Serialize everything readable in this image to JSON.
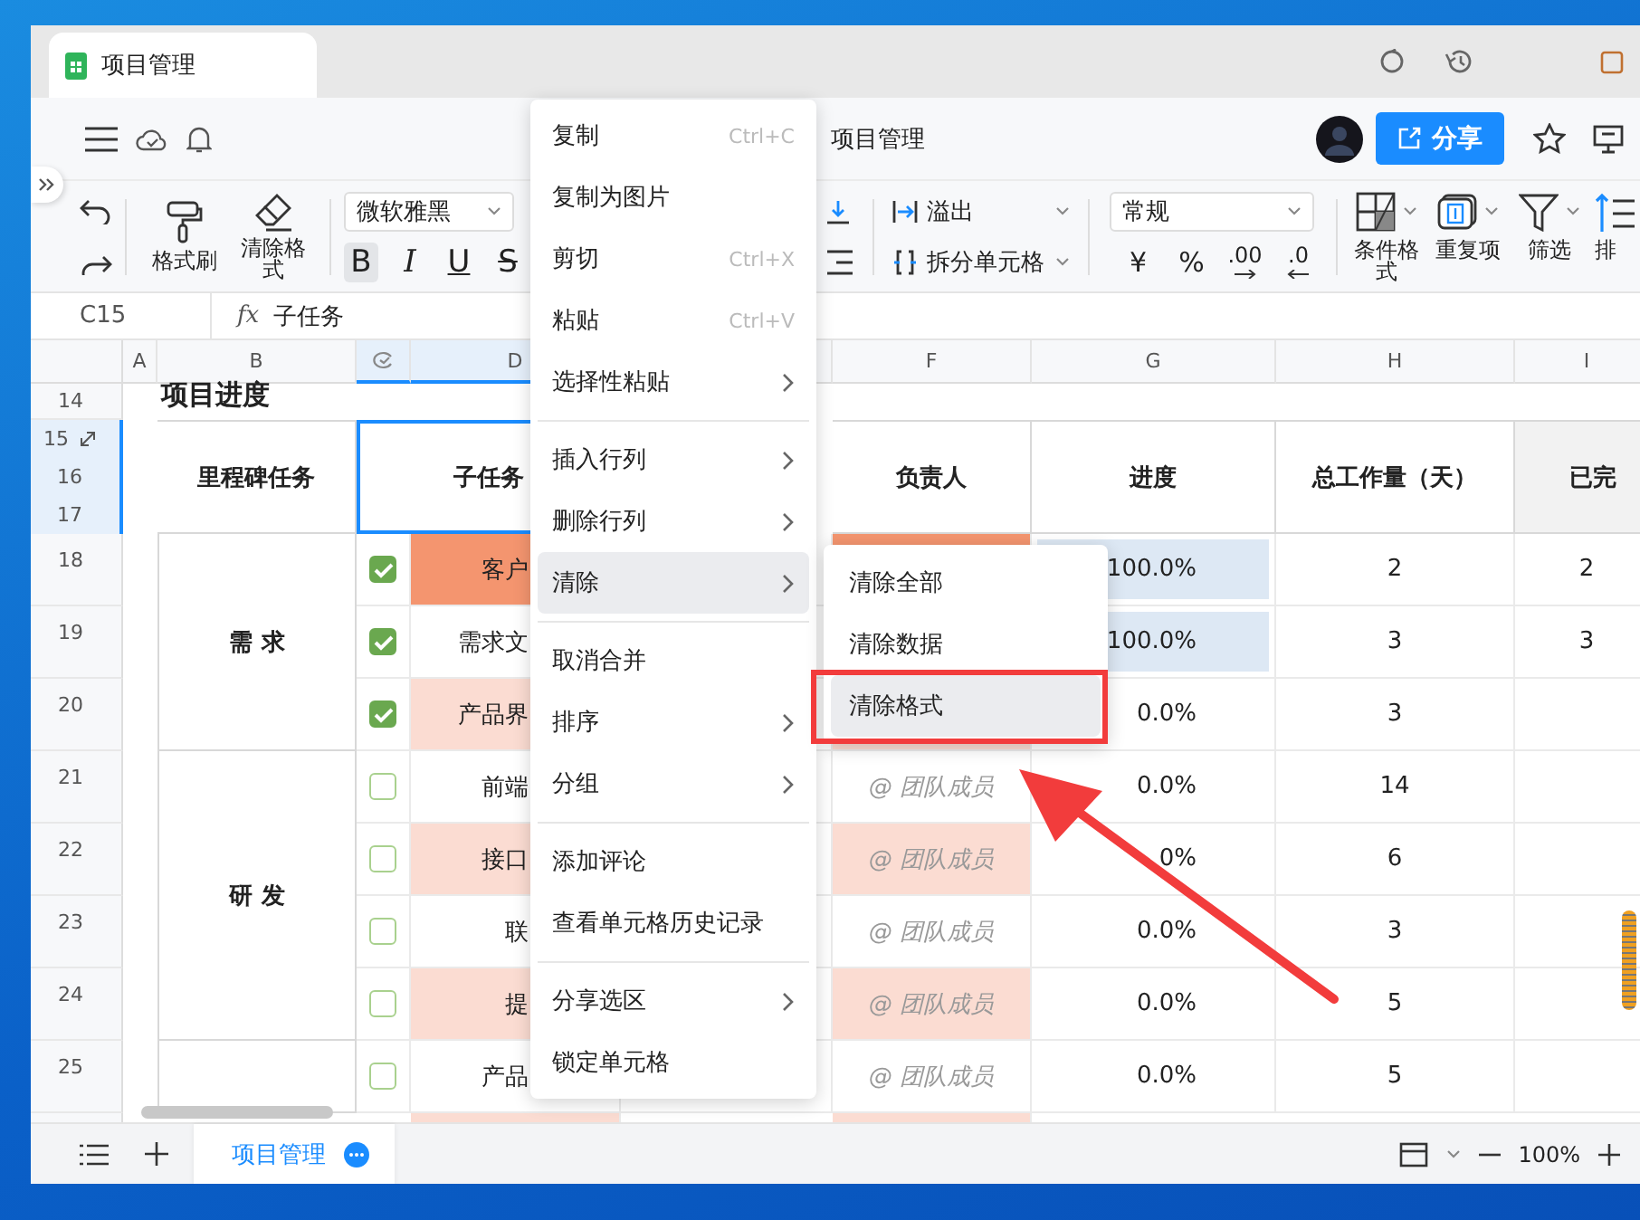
{
  "window": {
    "tab_title": "项目管理"
  },
  "header": {
    "doc_title": "项目管理",
    "share": "分享"
  },
  "toolbar": {
    "format_painter": "格式刷",
    "clear_format": "清除格式",
    "font": "微软雅黑",
    "text_styles": [
      {
        "kind": "bold",
        "label": "B",
        "selected": true
      },
      {
        "kind": "italic",
        "label": "I",
        "selected": false
      },
      {
        "kind": "underline",
        "label": "U",
        "selected": false
      },
      {
        "kind": "strike",
        "label": "S",
        "selected": false
      }
    ],
    "overflow": "溢出",
    "split": "拆分单元格",
    "number_format": "常规",
    "number_buttons": [
      {
        "kind": "plain",
        "label": "¥"
      },
      {
        "kind": "plain",
        "label": "%"
      },
      {
        "kind": "more",
        "label": ".00"
      },
      {
        "kind": "less",
        "label": ".0"
      }
    ],
    "tools": [
      {
        "kind": "conditional",
        "label": "条件格式"
      },
      {
        "kind": "duplicate",
        "label": "重复项"
      },
      {
        "kind": "filter",
        "label": "筛选"
      },
      {
        "kind": "sort",
        "label": "排"
      }
    ]
  },
  "formula_bar": {
    "cell": "C15",
    "fx": "fx",
    "value": "子任务"
  },
  "sheet": {
    "columns": [
      {
        "kind": "letter",
        "label": "A",
        "selected": false
      },
      {
        "kind": "letter",
        "label": "B",
        "selected": false
      },
      {
        "kind": "checkbox",
        "selected": true
      },
      {
        "kind": "letter",
        "label": "D",
        "selected": true
      },
      {
        "kind": "blank",
        "selected": false
      },
      {
        "kind": "letter",
        "label": "F",
        "selected": false
      },
      {
        "kind": "letter",
        "label": "G",
        "selected": false
      },
      {
        "kind": "letter",
        "label": "H",
        "selected": false
      },
      {
        "kind": "letter",
        "label": "I",
        "selected": false
      }
    ],
    "row_numbers": [
      {
        "label": "14",
        "selected": false
      },
      {
        "label": "15",
        "selected": true
      },
      {
        "label": "16",
        "selected": true
      },
      {
        "label": "17",
        "selected": true
      },
      {
        "label": "18",
        "selected": false
      },
      {
        "label": "19",
        "selected": false
      },
      {
        "label": "20",
        "selected": false
      },
      {
        "label": "21",
        "selected": false
      },
      {
        "label": "22",
        "selected": false
      },
      {
        "label": "23",
        "selected": false
      },
      {
        "label": "24",
        "selected": false
      },
      {
        "label": "25",
        "selected": false
      }
    ],
    "title": "项目进度",
    "headers": [
      {
        "text": "里程碑任务",
        "selected": false
      },
      {
        "text": "子任务",
        "selected": true
      },
      {
        "text": "负责人",
        "selected": false
      },
      {
        "text": "进度",
        "selected": false
      },
      {
        "text": "总工作量（天）",
        "selected": false
      },
      {
        "text": "已完",
        "selected": false
      }
    ],
    "groups": [
      {
        "label": "需 求",
        "rows": [
          {
            "done": true,
            "subtask": "客户",
            "color": "#f4956f",
            "progress": "100.0%",
            "complete": true,
            "total": "2",
            "finished": "2"
          },
          {
            "done": true,
            "subtask": "需求文",
            "progress": "100.0%",
            "complete": true,
            "total": "3",
            "finished": "3"
          },
          {
            "done": true,
            "subtask": "产品界",
            "color": "#fbdcd2",
            "progress": "0.0%",
            "complete": false,
            "total": "3"
          }
        ]
      },
      {
        "label": "研 发",
        "rows": [
          {
            "done": false,
            "subtask": "前端",
            "owner": "@ 团队成员",
            "progress": "0.0%",
            "complete": false,
            "total": "14"
          },
          {
            "done": false,
            "subtask": "接口",
            "color": "#fbdcd2",
            "owner": "@ 团队成员",
            "progress": "0%",
            "complete": false,
            "total": "6"
          },
          {
            "done": false,
            "subtask": "联",
            "owner": "@ 团队成员",
            "progress": "0.0%",
            "complete": false,
            "total": "3"
          },
          {
            "done": false,
            "subtask": "提",
            "color": "#fbdcd2",
            "owner": "@ 团队成员",
            "progress": "0.0%",
            "complete": false,
            "total": "5"
          }
        ]
      },
      {
        "rows": [
          {
            "done": false,
            "subtask": "产品",
            "owner": "@ 团队成员",
            "progress": "0.0%",
            "complete": false,
            "total": "5"
          }
        ]
      }
    ]
  },
  "context_menu": {
    "groups": [
      [
        {
          "label": "复制",
          "shortcut": "Ctrl+C",
          "submenu": false,
          "hovered": false
        },
        {
          "label": "复制为图片",
          "submenu": false,
          "hovered": false
        },
        {
          "label": "剪切",
          "shortcut": "Ctrl+X",
          "submenu": false,
          "hovered": false
        },
        {
          "label": "粘贴",
          "shortcut": "Ctrl+V",
          "submenu": false,
          "hovered": false
        },
        {
          "label": "选择性粘贴",
          "submenu": true,
          "hovered": false
        }
      ],
      [
        {
          "label": "插入行列",
          "submenu": true,
          "hovered": false
        },
        {
          "label": "删除行列",
          "submenu": true,
          "hovered": false
        },
        {
          "label": "清除",
          "submenu": true,
          "hovered": true
        }
      ],
      [
        {
          "label": "取消合并",
          "submenu": false,
          "hovered": false
        },
        {
          "label": "排序",
          "submenu": true,
          "hovered": false
        },
        {
          "label": "分组",
          "submenu": true,
          "hovered": false
        }
      ],
      [
        {
          "label": "添加评论",
          "submenu": false,
          "hovered": false
        },
        {
          "label": "查看单元格历史记录",
          "submenu": false,
          "hovered": false
        }
      ],
      [
        {
          "label": "分享选区",
          "submenu": true,
          "hovered": false
        },
        {
          "label": "锁定单元格",
          "submenu": false,
          "hovered": false
        }
      ]
    ]
  },
  "submenu": [
    {
      "label": "清除全部",
      "hovered": false
    },
    {
      "label": "清除数据",
      "hovered": false
    },
    {
      "label": "清除格式",
      "hovered": true
    }
  ],
  "bottom_bar": {
    "sheet_tab": "项目管理",
    "zoom": "100%"
  }
}
